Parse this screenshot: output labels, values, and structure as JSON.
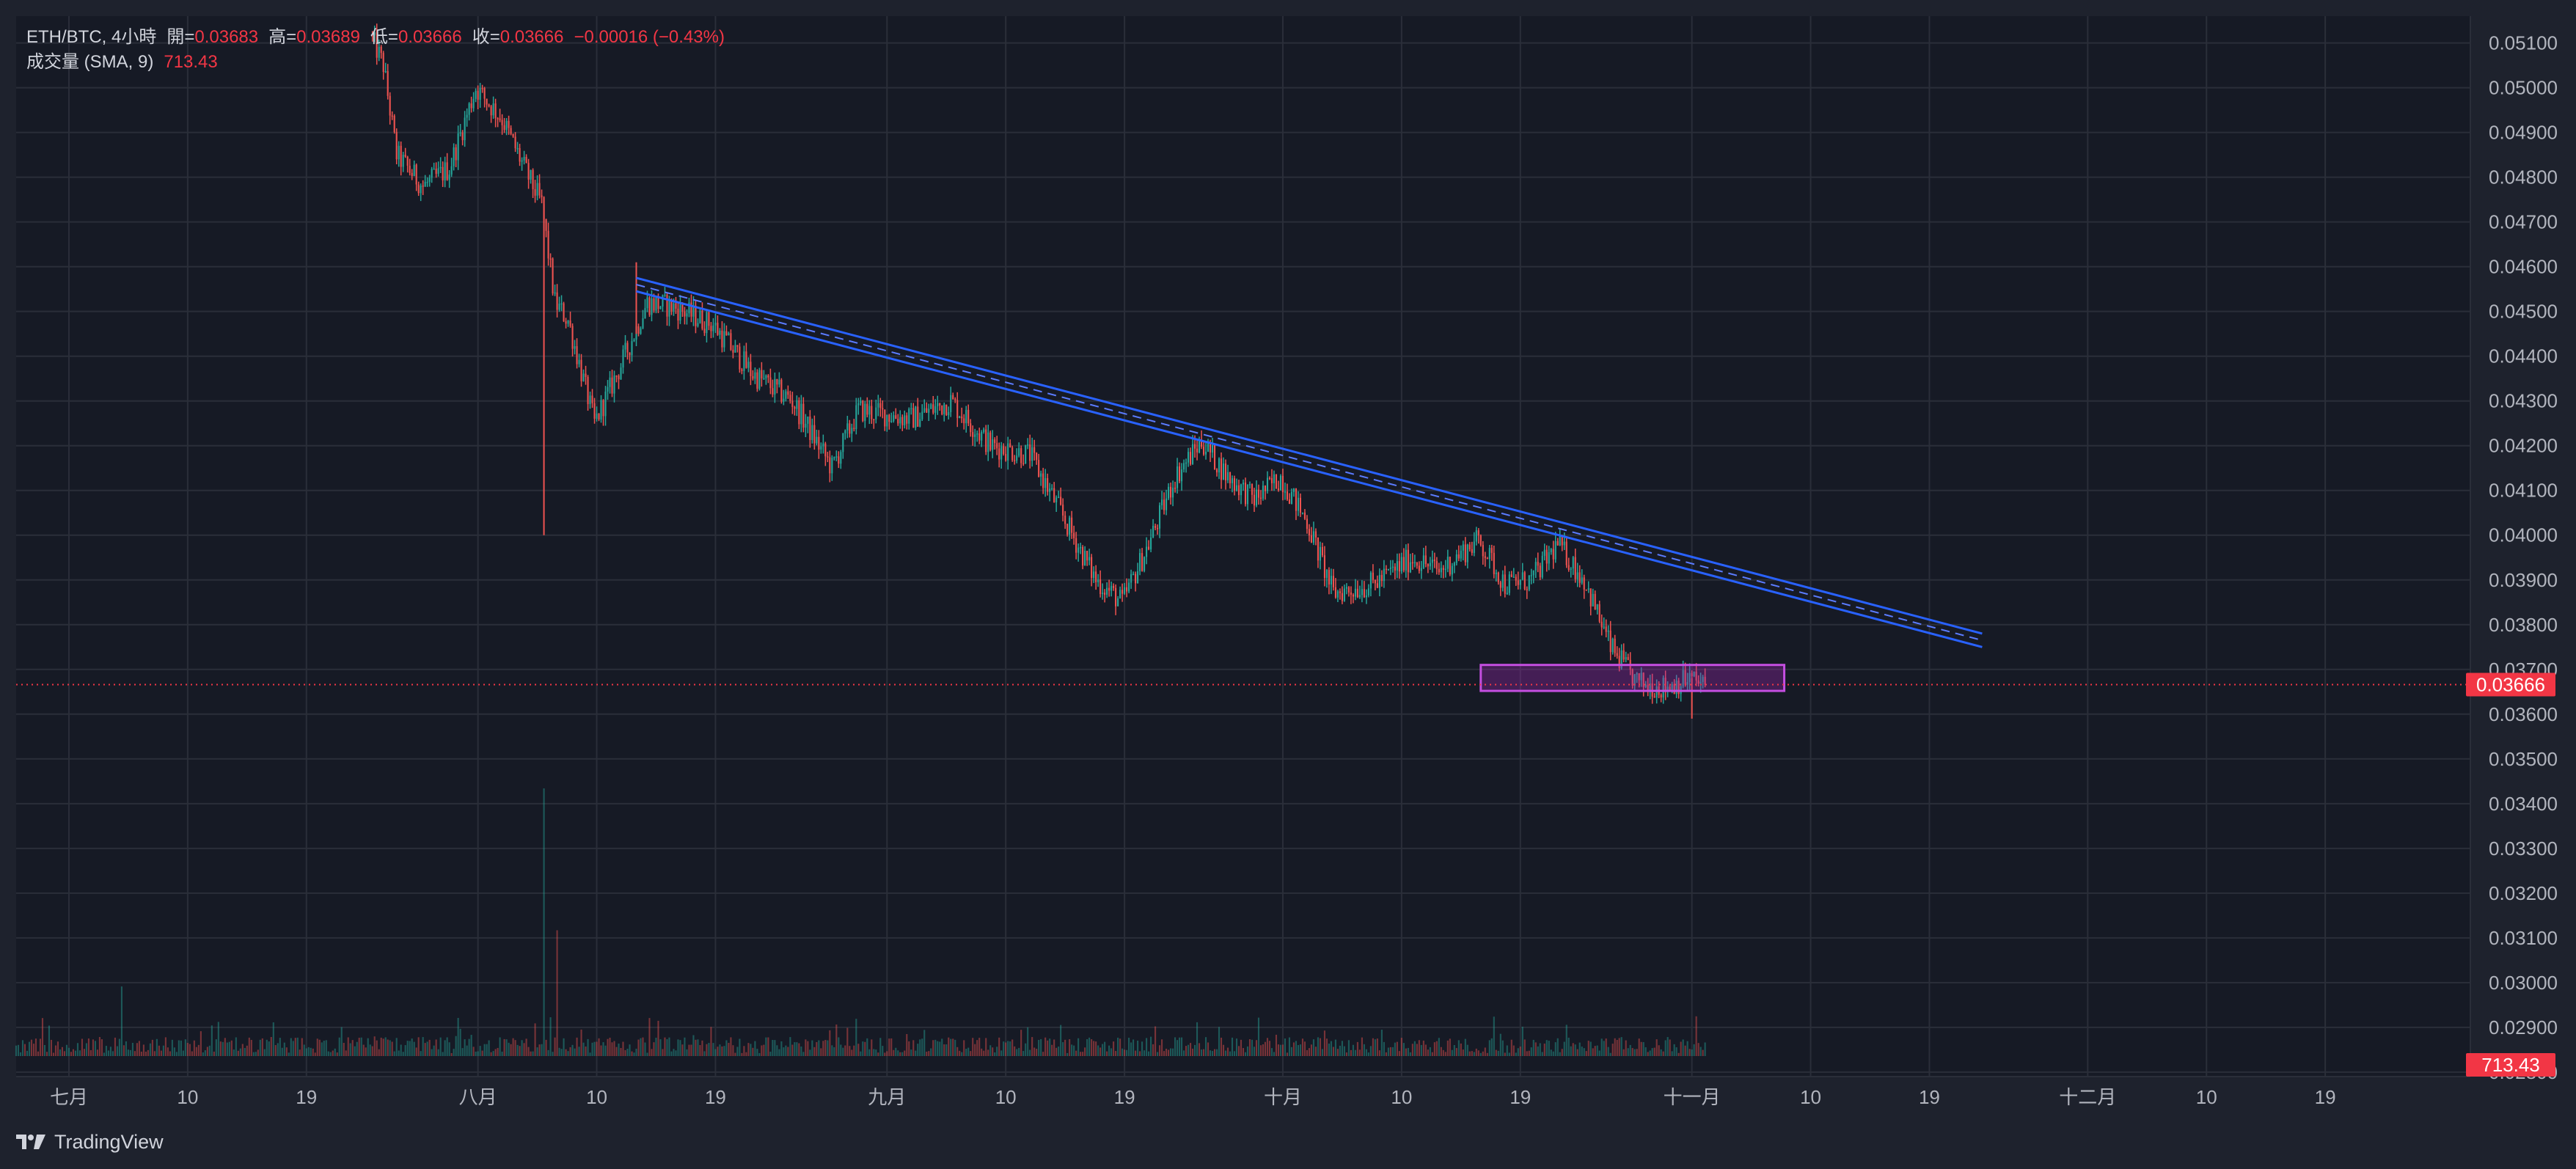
{
  "header": {
    "symbol": "ETH/BTC, 4小時",
    "open_label": "開=",
    "open_value": "0.03683",
    "high_label": "高=",
    "high_value": "0.03689",
    "low_label": "低=",
    "low_value": "0.03666",
    "close_label": "收=",
    "close_value": "0.03666",
    "change": "−0.00016 (−0.43%)",
    "volume_label": "成交量 (SMA, 9)",
    "volume_value": "713.43"
  },
  "footer": {
    "brand": "TradingView",
    "logo_icon": "tradingview-logo-icon"
  },
  "colors": {
    "background": "#161a25",
    "frame": "#1e222d",
    "grid": "#2a2e39",
    "up": "#26a69a",
    "down": "#ef5350",
    "trendline": "#2962ff",
    "zone_border": "#c44ee0",
    "zone_fill": "#9c27b0",
    "price_badge": "#f23645",
    "axis_text": "#b2b5be"
  },
  "chart_data": {
    "type": "candlestick",
    "symbol": "ETH/BTC",
    "timeframe": "4h",
    "x_axis": {
      "ticks": [
        {
          "label": "七月",
          "date": "2022-07-01"
        },
        {
          "label": "10",
          "date": "2022-07-10"
        },
        {
          "label": "19",
          "date": "2022-07-19"
        },
        {
          "label": "八月",
          "date": "2022-08-01"
        },
        {
          "label": "10",
          "date": "2022-08-10"
        },
        {
          "label": "19",
          "date": "2022-08-19"
        },
        {
          "label": "九月",
          "date": "2022-09-01"
        },
        {
          "label": "10",
          "date": "2022-09-10"
        },
        {
          "label": "19",
          "date": "2022-09-19"
        },
        {
          "label": "十月",
          "date": "2022-10-01"
        },
        {
          "label": "10",
          "date": "2022-10-10"
        },
        {
          "label": "19",
          "date": "2022-10-19"
        },
        {
          "label": "十一月",
          "date": "2022-11-01"
        },
        {
          "label": "10",
          "date": "2022-11-10"
        },
        {
          "label": "19",
          "date": "2022-11-19"
        },
        {
          "label": "十二月",
          "date": "2022-12-01"
        },
        {
          "label": "10",
          "date": "2022-12-10"
        },
        {
          "label": "19",
          "date": "2022-12-19"
        }
      ],
      "range": [
        "2022-06-27",
        "2022-12-30"
      ]
    },
    "y_axis": {
      "ticks": [
        "0.05100",
        "0.05000",
        "0.04900",
        "0.04800",
        "0.04700",
        "0.04600",
        "0.04500",
        "0.04400",
        "0.04300",
        "0.04200",
        "0.04100",
        "0.04000",
        "0.03900",
        "0.03800",
        "0.03700",
        "0.03600",
        "0.03500",
        "0.03400",
        "0.03300",
        "0.03200",
        "0.03100",
        "0.03000",
        "0.02900",
        "0.02800"
      ],
      "range": [
        0.0279,
        0.0516
      ]
    },
    "price_path": [
      {
        "date": "2022-07-24",
        "price": 0.0512
      },
      {
        "date": "2022-07-25",
        "price": 0.0505
      },
      {
        "date": "2022-07-26",
        "price": 0.0485
      },
      {
        "date": "2022-07-28",
        "price": 0.0478
      },
      {
        "date": "2022-07-30",
        "price": 0.0482
      },
      {
        "date": "2022-08-01",
        "price": 0.05
      },
      {
        "date": "2022-08-03",
        "price": 0.0493
      },
      {
        "date": "2022-08-05",
        "price": 0.048
      },
      {
        "date": "2022-08-06",
        "price": 0.0474
      },
      {
        "date": "2022-08-07",
        "price": 0.0452
      },
      {
        "date": "2022-08-08",
        "price": 0.0448
      },
      {
        "date": "2022-08-10",
        "price": 0.0425
      },
      {
        "date": "2022-08-12",
        "price": 0.0438
      },
      {
        "date": "2022-08-14",
        "price": 0.0452
      },
      {
        "date": "2022-08-16",
        "price": 0.0451
      },
      {
        "date": "2022-08-19",
        "price": 0.0447
      },
      {
        "date": "2022-08-22",
        "price": 0.0436
      },
      {
        "date": "2022-08-25",
        "price": 0.043
      },
      {
        "date": "2022-08-28",
        "price": 0.0415
      },
      {
        "date": "2022-08-30",
        "price": 0.0428
      },
      {
        "date": "2022-09-03",
        "price": 0.0426
      },
      {
        "date": "2022-09-06",
        "price": 0.043
      },
      {
        "date": "2022-09-09",
        "price": 0.042
      },
      {
        "date": "2022-09-12",
        "price": 0.0418
      },
      {
        "date": "2022-09-14",
        "price": 0.0407
      },
      {
        "date": "2022-09-17",
        "price": 0.039
      },
      {
        "date": "2022-09-19",
        "price": 0.0385
      },
      {
        "date": "2022-09-21",
        "price": 0.0398
      },
      {
        "date": "2022-09-23",
        "price": 0.0413
      },
      {
        "date": "2022-09-25",
        "price": 0.0421
      },
      {
        "date": "2022-09-27",
        "price": 0.0413
      },
      {
        "date": "2022-09-29",
        "price": 0.0408
      },
      {
        "date": "2022-10-01",
        "price": 0.0413
      },
      {
        "date": "2022-10-03",
        "price": 0.0403
      },
      {
        "date": "2022-10-05",
        "price": 0.0387
      },
      {
        "date": "2022-10-08",
        "price": 0.0389
      },
      {
        "date": "2022-10-11",
        "price": 0.0395
      },
      {
        "date": "2022-10-13",
        "price": 0.0392
      },
      {
        "date": "2022-10-16",
        "price": 0.0399
      },
      {
        "date": "2022-10-18",
        "price": 0.0389
      },
      {
        "date": "2022-10-20",
        "price": 0.039
      },
      {
        "date": "2022-10-22",
        "price": 0.0398
      },
      {
        "date": "2022-10-24",
        "price": 0.039
      },
      {
        "date": "2022-10-26",
        "price": 0.0375
      },
      {
        "date": "2022-10-28",
        "price": 0.0367
      },
      {
        "date": "2022-10-30",
        "price": 0.0366
      },
      {
        "date": "2022-11-01",
        "price": 0.0368
      },
      {
        "date": "2022-11-02",
        "price": 0.03666
      }
    ],
    "wicks": [
      {
        "date": "2022-08-06",
        "low": 0.04
      },
      {
        "date": "2022-08-13",
        "high": 0.0461
      },
      {
        "date": "2022-11-01",
        "low": 0.0359
      }
    ],
    "volume": {
      "sma_period": 9,
      "last": 713.43,
      "spikes": [
        {
          "date": "2022-07-05",
          "relative": 0.26
        },
        {
          "date": "2022-08-06",
          "relative": 1.0
        },
        {
          "date": "2022-08-07",
          "relative": 0.47
        }
      ]
    },
    "drawings": [
      {
        "type": "parallel_channel",
        "start": {
          "date": "2022-08-13",
          "price": 0.0456
        },
        "end": {
          "date": "2022-11-23",
          "price": 0.03765
        },
        "width": 0.0003
      },
      {
        "type": "rectangle",
        "start": {
          "date": "2022-10-16",
          "price": 0.0371
        },
        "end": {
          "date": "2022-11-08",
          "price": 0.03652
        }
      }
    ],
    "last_price": "0.03666",
    "last_price_value": 0.03666,
    "last_volume": "713.43"
  }
}
